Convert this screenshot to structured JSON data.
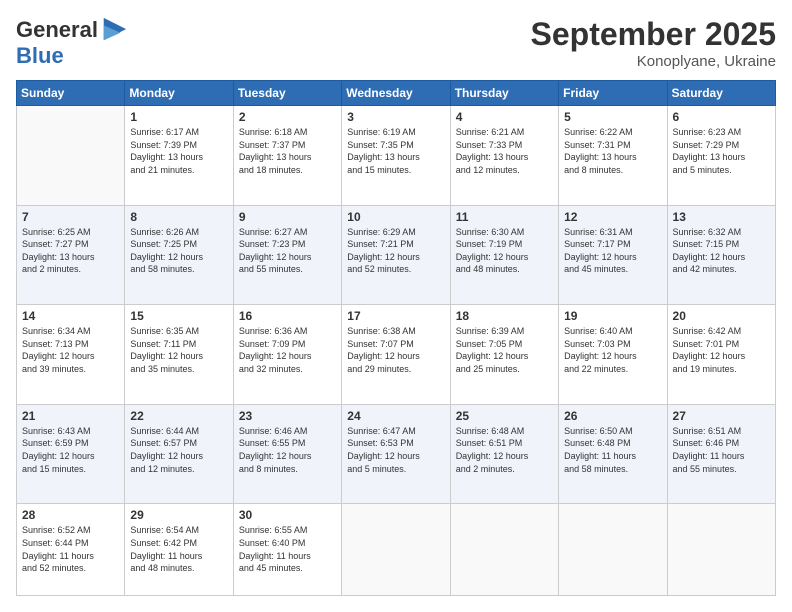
{
  "logo": {
    "line1": "General",
    "line2": "Blue"
  },
  "header": {
    "month": "September 2025",
    "location": "Konoplyane, Ukraine"
  },
  "weekdays": [
    "Sunday",
    "Monday",
    "Tuesday",
    "Wednesday",
    "Thursday",
    "Friday",
    "Saturday"
  ],
  "weeks": [
    [
      {
        "day": "",
        "info": ""
      },
      {
        "day": "1",
        "info": "Sunrise: 6:17 AM\nSunset: 7:39 PM\nDaylight: 13 hours\nand 21 minutes."
      },
      {
        "day": "2",
        "info": "Sunrise: 6:18 AM\nSunset: 7:37 PM\nDaylight: 13 hours\nand 18 minutes."
      },
      {
        "day": "3",
        "info": "Sunrise: 6:19 AM\nSunset: 7:35 PM\nDaylight: 13 hours\nand 15 minutes."
      },
      {
        "day": "4",
        "info": "Sunrise: 6:21 AM\nSunset: 7:33 PM\nDaylight: 13 hours\nand 12 minutes."
      },
      {
        "day": "5",
        "info": "Sunrise: 6:22 AM\nSunset: 7:31 PM\nDaylight: 13 hours\nand 8 minutes."
      },
      {
        "day": "6",
        "info": "Sunrise: 6:23 AM\nSunset: 7:29 PM\nDaylight: 13 hours\nand 5 minutes."
      }
    ],
    [
      {
        "day": "7",
        "info": "Sunrise: 6:25 AM\nSunset: 7:27 PM\nDaylight: 13 hours\nand 2 minutes."
      },
      {
        "day": "8",
        "info": "Sunrise: 6:26 AM\nSunset: 7:25 PM\nDaylight: 12 hours\nand 58 minutes."
      },
      {
        "day": "9",
        "info": "Sunrise: 6:27 AM\nSunset: 7:23 PM\nDaylight: 12 hours\nand 55 minutes."
      },
      {
        "day": "10",
        "info": "Sunrise: 6:29 AM\nSunset: 7:21 PM\nDaylight: 12 hours\nand 52 minutes."
      },
      {
        "day": "11",
        "info": "Sunrise: 6:30 AM\nSunset: 7:19 PM\nDaylight: 12 hours\nand 48 minutes."
      },
      {
        "day": "12",
        "info": "Sunrise: 6:31 AM\nSunset: 7:17 PM\nDaylight: 12 hours\nand 45 minutes."
      },
      {
        "day": "13",
        "info": "Sunrise: 6:32 AM\nSunset: 7:15 PM\nDaylight: 12 hours\nand 42 minutes."
      }
    ],
    [
      {
        "day": "14",
        "info": "Sunrise: 6:34 AM\nSunset: 7:13 PM\nDaylight: 12 hours\nand 39 minutes."
      },
      {
        "day": "15",
        "info": "Sunrise: 6:35 AM\nSunset: 7:11 PM\nDaylight: 12 hours\nand 35 minutes."
      },
      {
        "day": "16",
        "info": "Sunrise: 6:36 AM\nSunset: 7:09 PM\nDaylight: 12 hours\nand 32 minutes."
      },
      {
        "day": "17",
        "info": "Sunrise: 6:38 AM\nSunset: 7:07 PM\nDaylight: 12 hours\nand 29 minutes."
      },
      {
        "day": "18",
        "info": "Sunrise: 6:39 AM\nSunset: 7:05 PM\nDaylight: 12 hours\nand 25 minutes."
      },
      {
        "day": "19",
        "info": "Sunrise: 6:40 AM\nSunset: 7:03 PM\nDaylight: 12 hours\nand 22 minutes."
      },
      {
        "day": "20",
        "info": "Sunrise: 6:42 AM\nSunset: 7:01 PM\nDaylight: 12 hours\nand 19 minutes."
      }
    ],
    [
      {
        "day": "21",
        "info": "Sunrise: 6:43 AM\nSunset: 6:59 PM\nDaylight: 12 hours\nand 15 minutes."
      },
      {
        "day": "22",
        "info": "Sunrise: 6:44 AM\nSunset: 6:57 PM\nDaylight: 12 hours\nand 12 minutes."
      },
      {
        "day": "23",
        "info": "Sunrise: 6:46 AM\nSunset: 6:55 PM\nDaylight: 12 hours\nand 8 minutes."
      },
      {
        "day": "24",
        "info": "Sunrise: 6:47 AM\nSunset: 6:53 PM\nDaylight: 12 hours\nand 5 minutes."
      },
      {
        "day": "25",
        "info": "Sunrise: 6:48 AM\nSunset: 6:51 PM\nDaylight: 12 hours\nand 2 minutes."
      },
      {
        "day": "26",
        "info": "Sunrise: 6:50 AM\nSunset: 6:48 PM\nDaylight: 11 hours\nand 58 minutes."
      },
      {
        "day": "27",
        "info": "Sunrise: 6:51 AM\nSunset: 6:46 PM\nDaylight: 11 hours\nand 55 minutes."
      }
    ],
    [
      {
        "day": "28",
        "info": "Sunrise: 6:52 AM\nSunset: 6:44 PM\nDaylight: 11 hours\nand 52 minutes."
      },
      {
        "day": "29",
        "info": "Sunrise: 6:54 AM\nSunset: 6:42 PM\nDaylight: 11 hours\nand 48 minutes."
      },
      {
        "day": "30",
        "info": "Sunrise: 6:55 AM\nSunset: 6:40 PM\nDaylight: 11 hours\nand 45 minutes."
      },
      {
        "day": "",
        "info": ""
      },
      {
        "day": "",
        "info": ""
      },
      {
        "day": "",
        "info": ""
      },
      {
        "day": "",
        "info": ""
      }
    ]
  ]
}
